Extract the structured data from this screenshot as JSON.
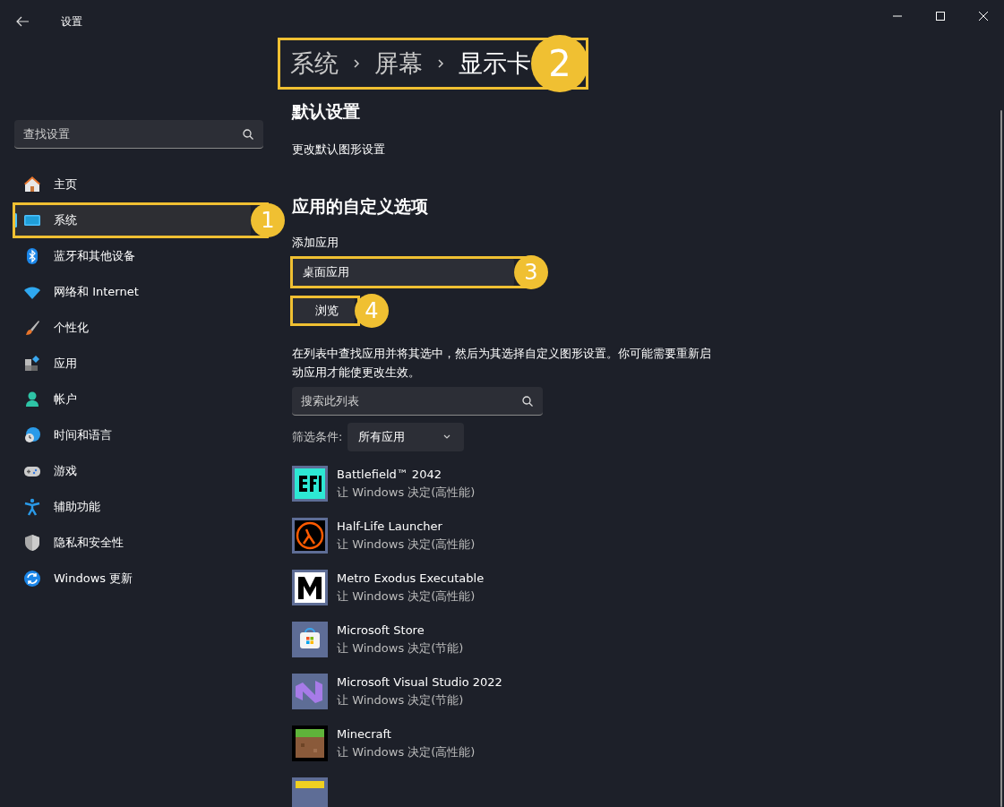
{
  "window": {
    "title": "设置"
  },
  "sidebar": {
    "search": {
      "placeholder": "查找设置"
    },
    "items": [
      {
        "label": "主页",
        "selected": false
      },
      {
        "label": "系统",
        "selected": true,
        "callout": "1"
      },
      {
        "label": "蓝牙和其他设备",
        "selected": false
      },
      {
        "label": "网络和 Internet",
        "selected": false
      },
      {
        "label": "个性化",
        "selected": false
      },
      {
        "label": "应用",
        "selected": false
      },
      {
        "label": "帐户",
        "selected": false
      },
      {
        "label": "时间和语言",
        "selected": false
      },
      {
        "label": "游戏",
        "selected": false
      },
      {
        "label": "辅助功能",
        "selected": false
      },
      {
        "label": "隐私和安全性",
        "selected": false
      },
      {
        "label": "Windows 更新",
        "selected": false
      }
    ]
  },
  "breadcrumb": {
    "items": [
      {
        "label": "系统",
        "current": false
      },
      {
        "label": "屏幕",
        "current": false
      },
      {
        "label": "显示卡",
        "current": true
      }
    ],
    "callout": "2"
  },
  "default_section": {
    "heading": "默认设置",
    "link": "更改默认图形设置"
  },
  "custom_section": {
    "heading": "应用的自定义选项",
    "add_label": "添加应用",
    "app_type": {
      "value": "桌面应用",
      "callout": "3"
    },
    "browse": {
      "label": "浏览",
      "callout": "4"
    },
    "description": "在列表中查找应用并将其选中，然后为其选择自定义图形设置。你可能需要重新启动应用才能使更改生效。",
    "search": {
      "placeholder": "搜索此列表"
    },
    "filter": {
      "label": "筛选条件:",
      "value": "所有应用"
    }
  },
  "apps": [
    {
      "name": "Battlefield™ 2042",
      "setting": "让 Windows 决定(高性能)"
    },
    {
      "name": "Half-Life Launcher",
      "setting": "让 Windows 决定(高性能)"
    },
    {
      "name": "Metro Exodus Executable",
      "setting": "让 Windows 决定(高性能)"
    },
    {
      "name": "Microsoft Store",
      "setting": "让 Windows 决定(节能)"
    },
    {
      "name": "Microsoft Visual Studio 2022",
      "setting": "让 Windows 决定(节能)"
    },
    {
      "name": "Minecraft",
      "setting": "让 Windows 决定(高性能)"
    }
  ]
}
